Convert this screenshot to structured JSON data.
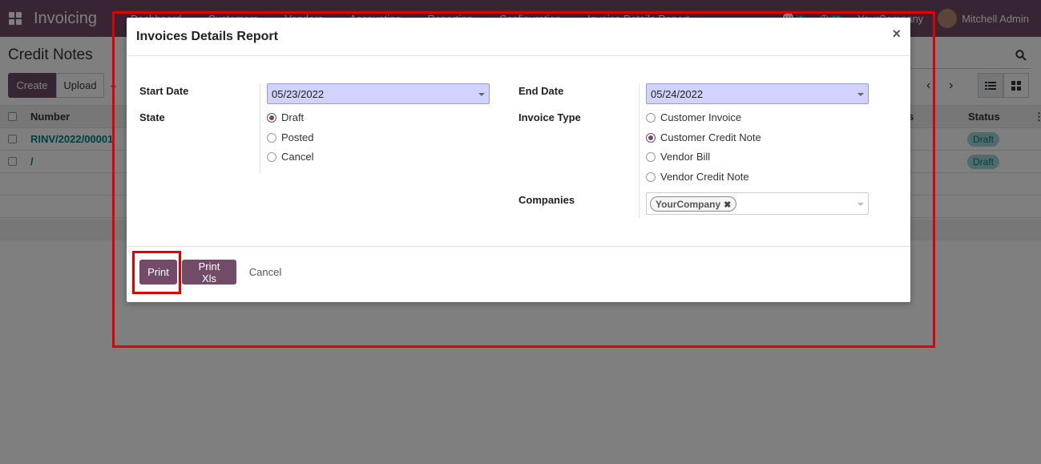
{
  "app": {
    "name": "Invoicing",
    "menu": [
      "Dashboard",
      "Customers",
      "Vendors",
      "Accounting",
      "Reporting",
      "Configuration",
      "Invoice Details Report"
    ],
    "company": "YourCompany",
    "user": "Mitchell Admin",
    "messages_count": "4",
    "activities_count": "12"
  },
  "page": {
    "title": "Credit Notes",
    "create_label": "Create",
    "upload_label": "Upload"
  },
  "table": {
    "columns": {
      "number": "Number",
      "hidden_col": "us",
      "status": "Status"
    },
    "rows": [
      {
        "number": "RINV/2022/00001",
        "status": "Draft"
      },
      {
        "number": "/",
        "status": "Draft"
      }
    ]
  },
  "dialog": {
    "title": "Invoices Details Report",
    "close": "×",
    "start_date_label": "Start Date",
    "start_date": "05/23/2022",
    "end_date_label": "End Date",
    "end_date": "05/24/2022",
    "state_label": "State",
    "state_options": [
      "Draft",
      "Posted",
      "Cancel"
    ],
    "state_selected": "Draft",
    "invoice_type_label": "Invoice Type",
    "invoice_type_options": [
      "Customer Invoice",
      "Customer Credit Note",
      "Vendor Bill",
      "Vendor Credit Note"
    ],
    "invoice_type_selected": "Customer Credit Note",
    "companies_label": "Companies",
    "companies_tag": "YourCompany",
    "print_label": "Print",
    "print_xls_label": "Print Xls",
    "cancel_label": "Cancel"
  },
  "colors": {
    "brand": "#714b67",
    "highlight": "#e00000",
    "date_field_bg": "#d2d2ff",
    "status_badge_bg": "#a2d6d8"
  }
}
